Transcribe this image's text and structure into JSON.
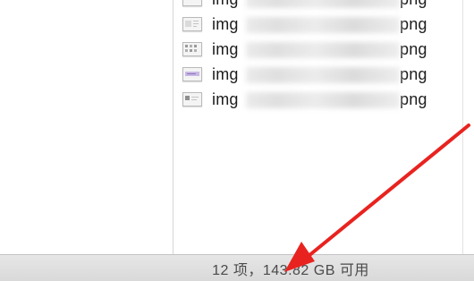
{
  "files": [
    {
      "prefix": "img",
      "ext": "png",
      "icon": "image-thumbnail-icon"
    },
    {
      "prefix": "img",
      "ext": "png",
      "icon": "image-thumbnail-icon"
    },
    {
      "prefix": "img",
      "ext": "png",
      "icon": "image-thumbnail-icon"
    },
    {
      "prefix": "img",
      "ext": "png",
      "icon": "image-thumbnail-icon"
    },
    {
      "prefix": "img",
      "ext": "png",
      "icon": "image-thumbnail-icon"
    }
  ],
  "status_bar": {
    "text": "12 项，143.82 GB 可用"
  },
  "annotation": {
    "arrow_color": "#e8231f"
  }
}
